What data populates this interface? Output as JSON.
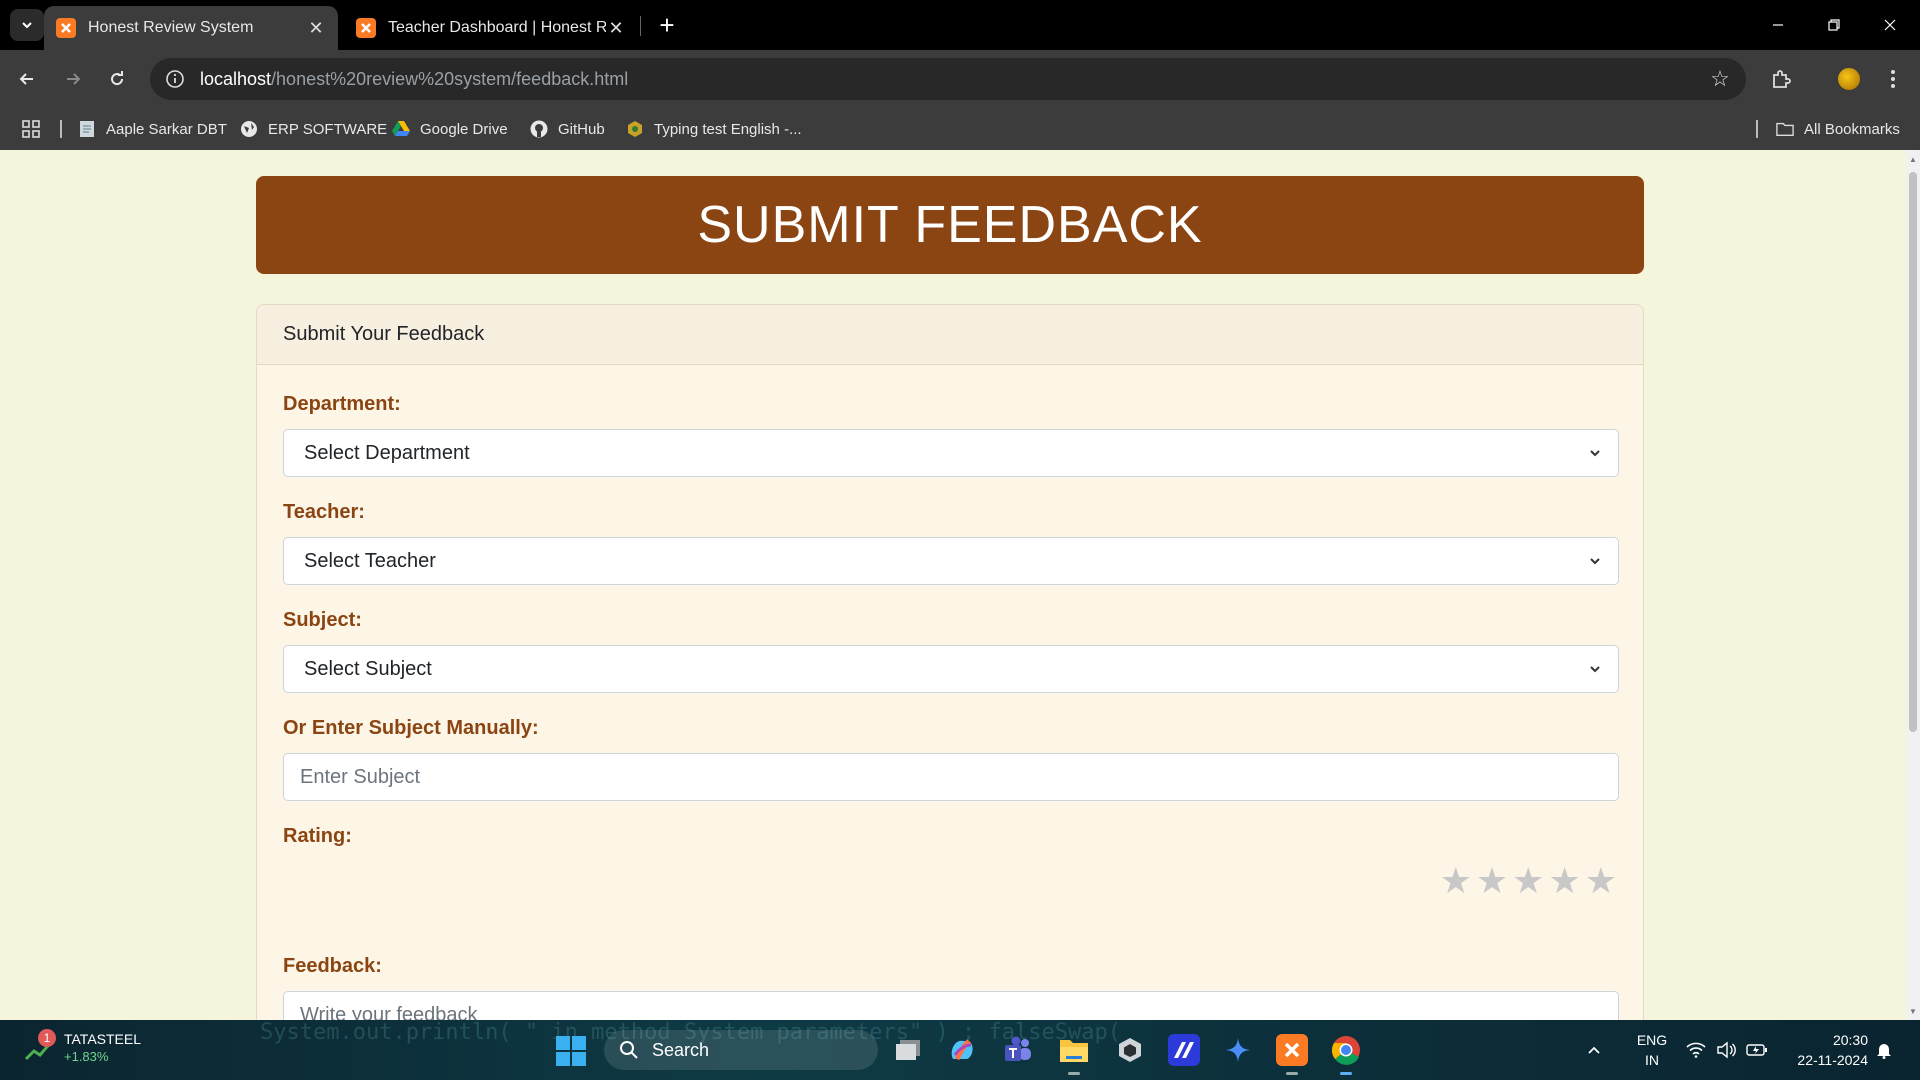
{
  "browser": {
    "tabs": [
      {
        "title": "Honest Review System",
        "active": true
      },
      {
        "title": "Teacher Dashboard | Honest Re",
        "active": false
      }
    ],
    "url_host": "localhost",
    "url_path": "/honest%20review%20system/feedback.html",
    "bookmarks": [
      {
        "label": "Aaple Sarkar DBT",
        "icon": "page-icon"
      },
      {
        "label": "ERP SOFTWARE",
        "icon": "globe-icon"
      },
      {
        "label": "Google Drive",
        "icon": "drive-icon"
      },
      {
        "label": "GitHub",
        "icon": "github-icon"
      },
      {
        "label": "Typing test English -...",
        "icon": "typing-icon"
      }
    ],
    "all_bookmarks_label": "All Bookmarks"
  },
  "page": {
    "banner_title": "SUBMIT FEEDBACK",
    "card_title": "Submit Your Feedback",
    "department": {
      "label": "Department:",
      "value": "Select Department"
    },
    "teacher": {
      "label": "Teacher:",
      "value": "Select Teacher"
    },
    "subject": {
      "label": "Subject:",
      "value": "Select Subject"
    },
    "manual_subject": {
      "label": "Or Enter Subject Manually:",
      "placeholder": "Enter Subject"
    },
    "rating": {
      "label": "Rating:",
      "max": 5,
      "value": 0,
      "star_glyph": "★"
    },
    "feedback": {
      "label": "Feedback:",
      "placeholder": "Write your feedback"
    }
  },
  "taskbar": {
    "stock_name": "TATASTEEL",
    "stock_change": "+1.83%",
    "notification_count": "1",
    "search_label": "Search",
    "lang_line1": "ENG",
    "lang_line2": "IN",
    "time": "20:30",
    "date": "22-11-2024",
    "background_code": "System.out.println( \" in method System parameters\" ) ; falseSwap("
  },
  "colors": {
    "banner": "#8b4513",
    "label": "#8b4513",
    "page_bg": "#f5f5dc",
    "card_bg": "#fdf5e6",
    "star_empty": "#c8c8c8"
  }
}
